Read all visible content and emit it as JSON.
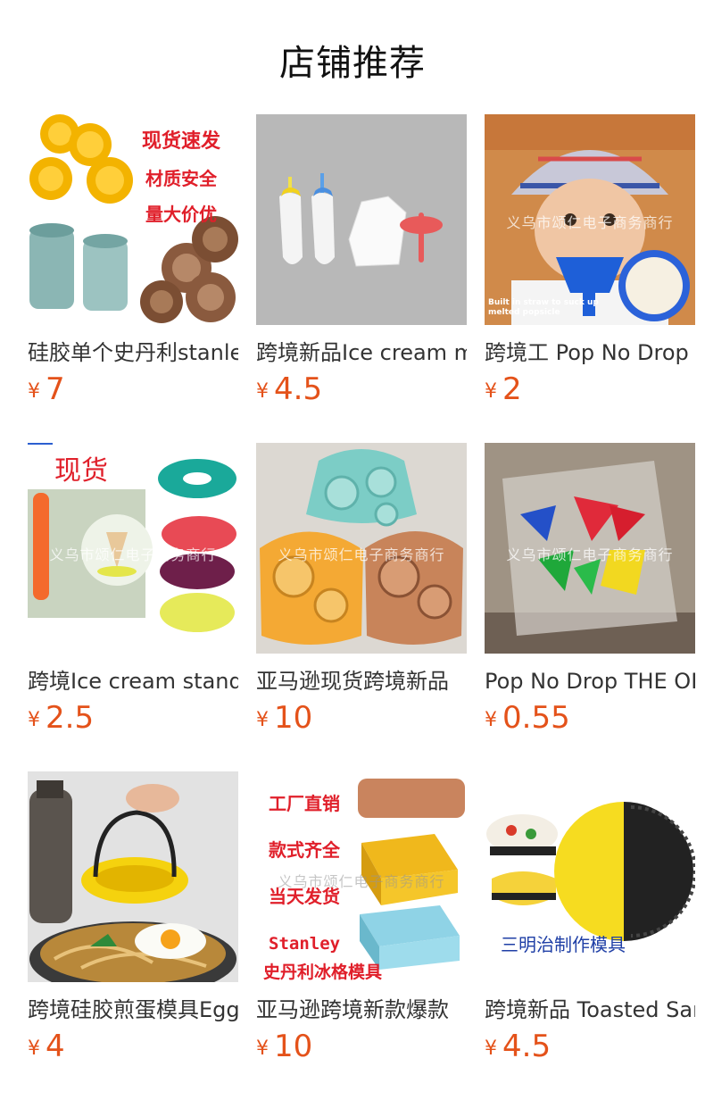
{
  "header": {
    "title": "店铺推荐"
  },
  "products": [
    {
      "name": "硅胶单个史丹利stanley",
      "currency": "¥",
      "price": "7",
      "image_text": [
        "现货速发",
        "材质安全",
        "量大价优"
      ]
    },
    {
      "name": "跨境新品Ice cream mold",
      "currency": "¥",
      "price": "4.5"
    },
    {
      "name": "跨境工 Pop No Drop",
      "currency": "¥",
      "price": "2",
      "image_text": [
        "义乌市颂仁电子商务商行",
        "Built in straw to suck up melted popsicle"
      ]
    },
    {
      "name": "跨境Ice cream stand",
      "currency": "¥",
      "price": "2.5",
      "image_text": [
        "现货",
        "义乌市颂仁电子商务商行"
      ]
    },
    {
      "name": "亚马逊现货跨境新品",
      "currency": "¥",
      "price": "10",
      "image_text": [
        "义乌市颂仁电子商务商行"
      ]
    },
    {
      "name": "Pop No Drop THE ORIGINAL",
      "currency": "¥",
      "price": "0.55",
      "image_text": [
        "义乌市颂仁电子商务商行"
      ]
    },
    {
      "name": "跨境硅胶煎蛋模具Egg",
      "currency": "¥",
      "price": "4"
    },
    {
      "name": "亚马逊跨境新款爆款",
      "currency": "¥",
      "price": "10",
      "image_text": [
        "工厂直销",
        "款式齐全",
        "当天发货",
        "Stanley",
        "史丹利冰格模具",
        "义乌市颂仁电子商务商行"
      ]
    },
    {
      "name": "跨境新品 Toasted Sandwich",
      "currency": "¥",
      "price": "4.5",
      "image_text": [
        "三明治制作模具"
      ]
    }
  ]
}
